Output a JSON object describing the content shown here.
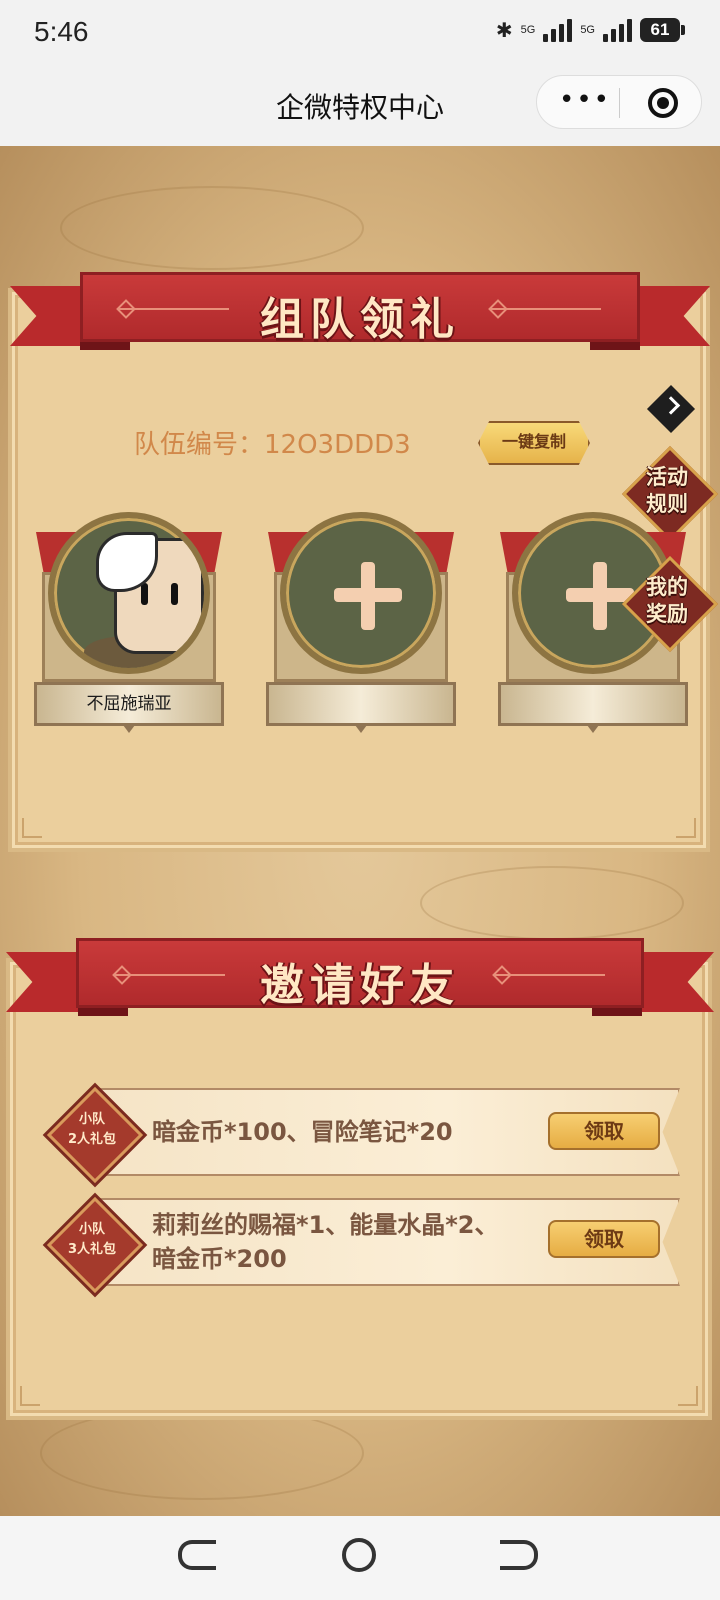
{
  "status_bar": {
    "time": "5:46",
    "network_1": "5G",
    "network_2": "5G",
    "battery": "61"
  },
  "title_bar": {
    "title": "企微特权中心",
    "more_icon": "more-dots-icon",
    "close_icon": "target-close-icon"
  },
  "team_section": {
    "banner_title": "组队领礼",
    "team_number_text": "队伍编号：12O3DDD3",
    "copy_button": "一键复制",
    "side_buttons": {
      "rules": "活动\n规则",
      "rewards": "我的\n奖励"
    },
    "members": [
      {
        "name": "不屈施瑞亚",
        "state": "filled"
      },
      {
        "name": "",
        "state": "empty"
      },
      {
        "name": "",
        "state": "empty"
      }
    ]
  },
  "invite_section": {
    "banner_title": "邀请好友",
    "rewards": [
      {
        "badge_line1": "小队",
        "badge_line2": "2人礼包",
        "text": "暗金币*100、冒险笔记*20",
        "button": "领取"
      },
      {
        "badge_line1": "小队",
        "badge_line2": "3人礼包",
        "text_line1": "莉莉丝的赐福*1、能量水晶*2、",
        "text_line2": "暗金币*200",
        "button": "领取"
      }
    ]
  },
  "colors": {
    "banner_red": "#b92a2c",
    "panel_bg": "#ebcf9d",
    "team_text": "#d1884a",
    "button_gold": "#e6ad43"
  }
}
